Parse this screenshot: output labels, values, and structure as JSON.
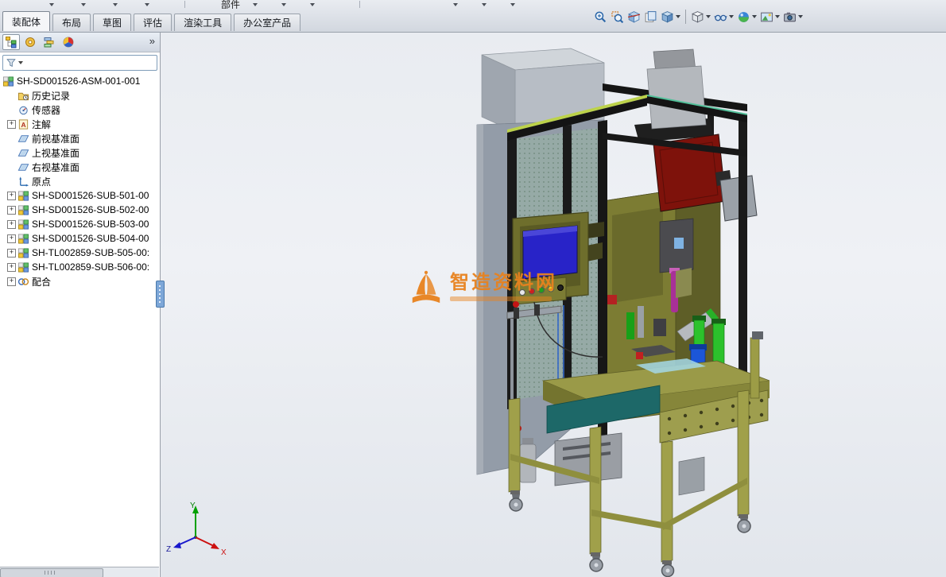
{
  "top_strip": {
    "fragment_label": "部件"
  },
  "command_tabs": [
    {
      "label": "装配体",
      "active": true
    },
    {
      "label": "布局",
      "active": false
    },
    {
      "label": "草图",
      "active": false
    },
    {
      "label": "评估",
      "active": false
    },
    {
      "label": "渲染工具",
      "active": false
    },
    {
      "label": "办公室产品",
      "active": false
    }
  ],
  "headsup": {
    "buttons": [
      {
        "icon": "zoom-fit-icon",
        "dropdown": false,
        "sep_before": false
      },
      {
        "icon": "zoom-area-icon",
        "dropdown": false,
        "sep_before": false
      },
      {
        "icon": "section-view-icon",
        "dropdown": false,
        "sep_before": false
      },
      {
        "icon": "drawing-3d-icon",
        "dropdown": false,
        "sep_before": false
      },
      {
        "icon": "view-orientation-icon",
        "dropdown": true,
        "sep_before": false
      },
      {
        "icon": "display-style-icon",
        "dropdown": true,
        "sep_before": true
      },
      {
        "icon": "hide-show-items-icon",
        "dropdown": true,
        "sep_before": false
      },
      {
        "icon": "edit-appearance-icon",
        "dropdown": true,
        "sep_before": false
      },
      {
        "icon": "apply-scene-icon",
        "dropdown": true,
        "sep_before": false
      },
      {
        "icon": "view-settings-icon",
        "dropdown": true,
        "sep_before": false
      }
    ]
  },
  "panel": {
    "manager_tabs": [
      {
        "icon": "feature-tree-icon",
        "active": true
      },
      {
        "icon": "property-manager-icon",
        "active": false
      },
      {
        "icon": "configuration-manager-icon",
        "active": false
      },
      {
        "icon": "display-manager-icon",
        "active": false
      }
    ],
    "overflow_chevron": "»",
    "filter": {
      "icon": "filter-funnel-icon"
    },
    "tree": [
      {
        "label": "SH-SD001526-ASM-001-001",
        "icon": "assembly-icon",
        "expander": false,
        "indent": 0
      },
      {
        "label": "历史记录",
        "icon": "history-icon",
        "expander": false,
        "indent": 1
      },
      {
        "label": "传感器",
        "icon": "sensors-icon",
        "expander": false,
        "indent": 1
      },
      {
        "label": "注解",
        "icon": "annotations-icon",
        "expander": true,
        "indent": 1
      },
      {
        "label": "前视基准面",
        "icon": "plane-icon",
        "expander": false,
        "indent": 1
      },
      {
        "label": "上视基准面",
        "icon": "plane-icon",
        "expander": false,
        "indent": 1
      },
      {
        "label": "右视基准面",
        "icon": "plane-icon",
        "expander": false,
        "indent": 1
      },
      {
        "label": "原点",
        "icon": "origin-icon",
        "expander": false,
        "indent": 1
      },
      {
        "label": "SH-SD001526-SUB-501-00",
        "icon": "assembly-icon",
        "expander": true,
        "indent": 1
      },
      {
        "label": "SH-SD001526-SUB-502-00",
        "icon": "assembly-icon",
        "expander": true,
        "indent": 1
      },
      {
        "label": "SH-SD001526-SUB-503-00",
        "icon": "assembly-icon",
        "expander": true,
        "indent": 1
      },
      {
        "label": "SH-SD001526-SUB-504-00",
        "icon": "assembly-icon",
        "expander": true,
        "indent": 1
      },
      {
        "label": "SH-TL002859-SUB-505-00:",
        "icon": "assembly-icon",
        "expander": true,
        "indent": 1
      },
      {
        "label": "SH-TL002859-SUB-506-00:",
        "icon": "assembly-icon",
        "expander": true,
        "indent": 1
      },
      {
        "label": "配合",
        "icon": "mates-icon",
        "expander": true,
        "indent": 1
      }
    ]
  },
  "viewport": {
    "watermark_text": "智造资料网",
    "watermark_color": "#e8821e",
    "triad": {
      "x_label": "X",
      "y_label": "Y",
      "z_label": "Z"
    },
    "triad_colors": {
      "x": "#cc1010",
      "y": "#00a000",
      "z": "#1818cc"
    }
  }
}
